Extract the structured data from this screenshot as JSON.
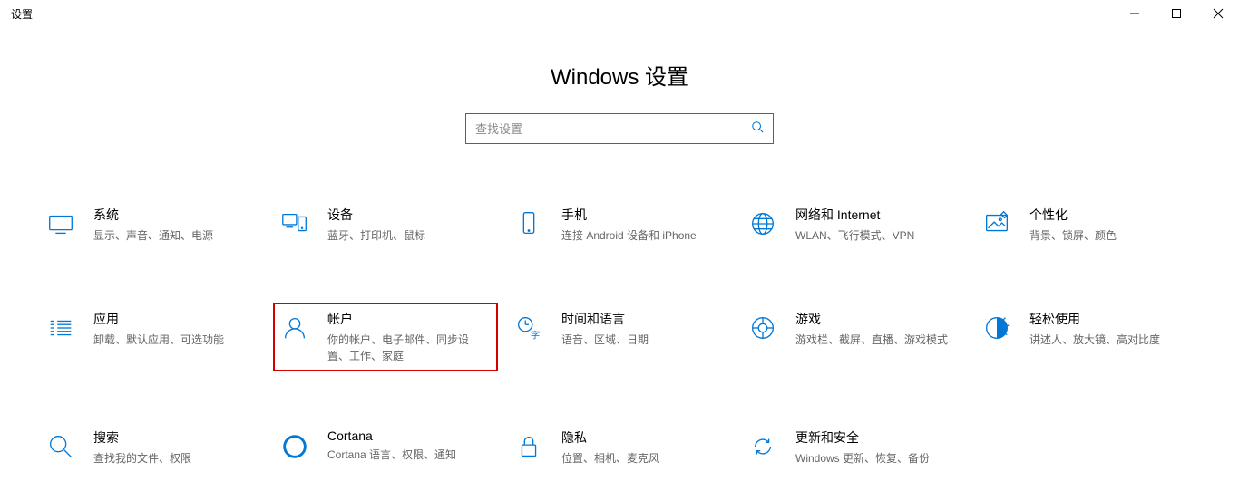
{
  "window": {
    "title": "设置"
  },
  "page": {
    "heading": "Windows 设置"
  },
  "search": {
    "placeholder": "查找设置"
  },
  "tiles": [
    {
      "id": "system",
      "title": "系统",
      "desc": "显示、声音、通知、电源"
    },
    {
      "id": "devices",
      "title": "设备",
      "desc": "蓝牙、打印机、鼠标"
    },
    {
      "id": "phone",
      "title": "手机",
      "desc": "连接 Android 设备和 iPhone"
    },
    {
      "id": "network",
      "title": "网络和 Internet",
      "desc": "WLAN、飞行模式、VPN"
    },
    {
      "id": "personalize",
      "title": "个性化",
      "desc": "背景、锁屏、颜色"
    },
    {
      "id": "apps",
      "title": "应用",
      "desc": "卸载、默认应用、可选功能"
    },
    {
      "id": "accounts",
      "title": "帐户",
      "desc": "你的帐户、电子邮件、同步设置、工作、家庭"
    },
    {
      "id": "timelang",
      "title": "时间和语言",
      "desc": "语音、区域、日期"
    },
    {
      "id": "gaming",
      "title": "游戏",
      "desc": "游戏栏、截屏、直播、游戏模式"
    },
    {
      "id": "ease",
      "title": "轻松使用",
      "desc": "讲述人、放大镜、高对比度"
    },
    {
      "id": "search",
      "title": "搜索",
      "desc": "查找我的文件、权限"
    },
    {
      "id": "cortana",
      "title": "Cortana",
      "desc": "Cortana 语言、权限、通知"
    },
    {
      "id": "privacy",
      "title": "隐私",
      "desc": "位置、相机、麦克风"
    },
    {
      "id": "update",
      "title": "更新和安全",
      "desc": "Windows 更新、恢复、备份"
    }
  ],
  "highlight_id": "accounts"
}
